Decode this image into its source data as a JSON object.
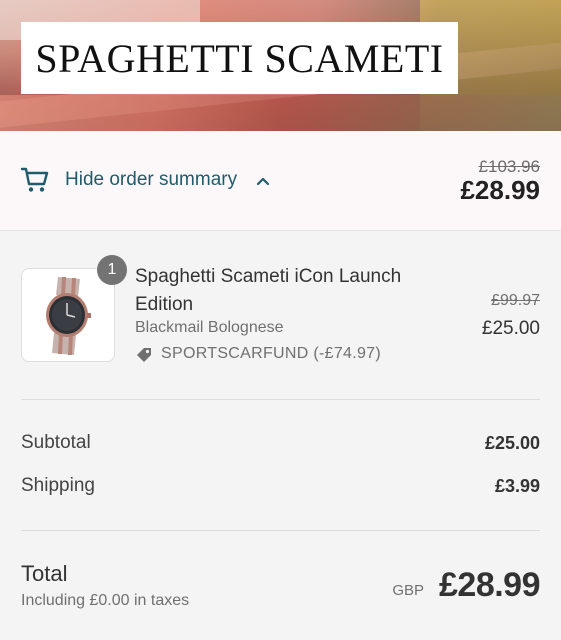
{
  "banner": {
    "title": "SPAGHETTI SCAMETI"
  },
  "summary": {
    "toggle_label": "Hide order summary",
    "original_total": "£103.96",
    "total": "£28.99",
    "icons": {
      "cart": "cart-icon",
      "chevron": "chevron-up-icon"
    }
  },
  "item": {
    "quantity": "1",
    "name": "Spaghetti Scameti iCon Launch Edition",
    "variant": "Blackmail Bolognese",
    "discount": "SPORTSCARFUND (-£74.97)",
    "original_price": "£99.97",
    "price": "£25.00",
    "icons": {
      "discount": "tag-icon",
      "image": "watch-image"
    }
  },
  "totals": {
    "subtotal_label": "Subtotal",
    "subtotal_value": "£25.00",
    "shipping_label": "Shipping",
    "shipping_value": "£3.99",
    "total_label": "Total",
    "tax_note": "Including £0.00 in taxes",
    "currency": "GBP",
    "total_value": "£28.99"
  },
  "colors": {
    "link": "#1f5b6b",
    "summary_bg": "#fcf8fa",
    "page_bg": "#f4f4f4"
  }
}
